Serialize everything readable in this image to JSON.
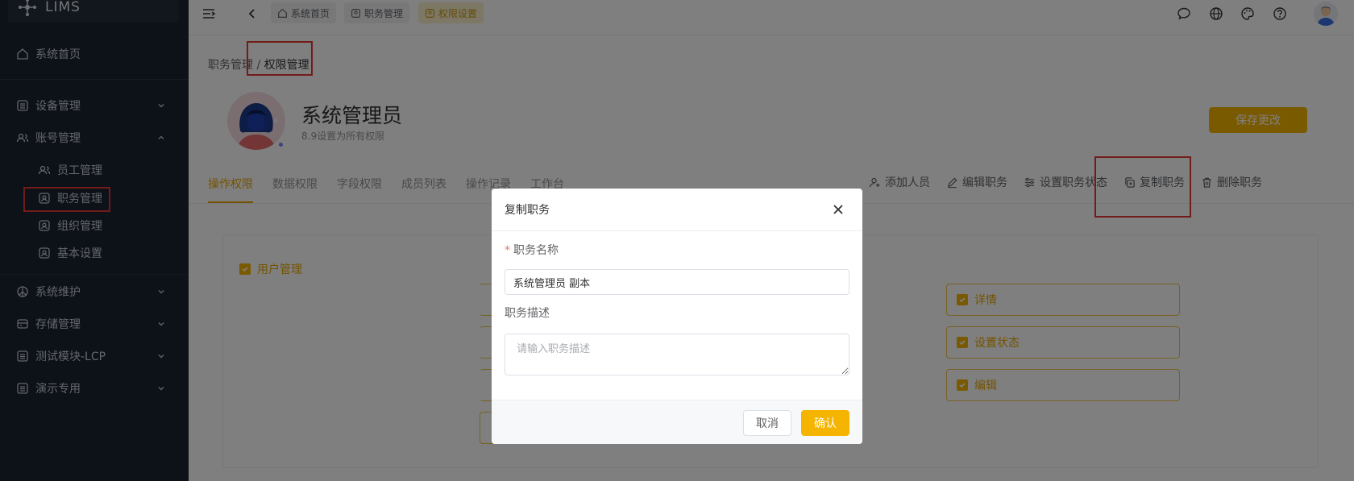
{
  "app": {
    "title": "LIMS"
  },
  "sidebar": {
    "items": [
      {
        "label": "系统首页"
      },
      {
        "label": "设备管理"
      },
      {
        "label": "账号管理"
      },
      {
        "label": "员工管理"
      },
      {
        "label": "职务管理"
      },
      {
        "label": "组织管理"
      },
      {
        "label": "基本设置"
      },
      {
        "label": "系统维护"
      },
      {
        "label": "存储管理"
      },
      {
        "label": "测试模块-LCP"
      },
      {
        "label": "演示专用"
      }
    ]
  },
  "topbar": {
    "tags": [
      {
        "label": "系统首页"
      },
      {
        "label": "职务管理"
      },
      {
        "label": "权限设置"
      }
    ]
  },
  "breadcrumb": {
    "parent": "职务管理",
    "separator": "/",
    "current": "权限管理"
  },
  "role": {
    "name": "系统管理员",
    "description": "8.9设置为所有权限"
  },
  "header": {
    "save_label": "保存更改"
  },
  "tabs": [
    {
      "label": "操作权限"
    },
    {
      "label": "数据权限"
    },
    {
      "label": "字段权限"
    },
    {
      "label": "成员列表"
    },
    {
      "label": "操作记录"
    },
    {
      "label": "工作台"
    }
  ],
  "actions": [
    {
      "label": "添加人员"
    },
    {
      "label": "编辑职务"
    },
    {
      "label": "设置职务状态"
    },
    {
      "label": "复制职务"
    },
    {
      "label": "删除职务"
    }
  ],
  "permissions": {
    "root": "用户管理",
    "items": [
      {
        "label": "详情"
      },
      {
        "label": "设置状态"
      },
      {
        "label": "编辑"
      }
    ]
  },
  "dialog": {
    "title": "复制职务",
    "name_label": "职务名称",
    "required_mark": "*",
    "name_value": "系统管理员 副本",
    "desc_label": "职务描述",
    "desc_placeholder": "请输入职务描述",
    "cancel_label": "取消",
    "confirm_label": "确认"
  },
  "colors": {
    "accent": "#f4b400",
    "sidebar_bg": "#1b2230",
    "highlight": "#e53935"
  }
}
